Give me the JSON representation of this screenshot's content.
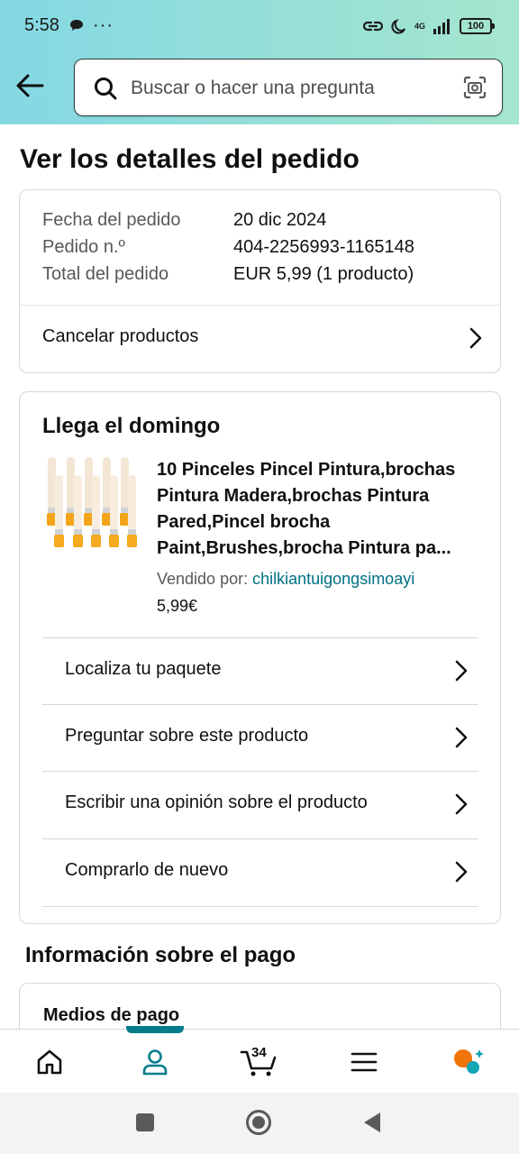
{
  "status_bar": {
    "time": "5:58",
    "more": "···",
    "network": "4G",
    "battery": "100"
  },
  "search": {
    "placeholder": "Buscar o hacer una pregunta"
  },
  "page": {
    "title": "Ver los detalles del pedido"
  },
  "order": {
    "date_label": "Fecha del pedido",
    "date_value": "20 dic 2024",
    "number_label": "Pedido n.º",
    "number_value": "404-2256993-1165148",
    "total_label": "Total del pedido",
    "total_value": "EUR 5,99 (1 producto)",
    "cancel_label": "Cancelar productos"
  },
  "shipment": {
    "arrival": "Llega el domingo",
    "product_title": "10 Pinceles Pincel Pintura,brochas Pintura Madera,brochas Pintura Pared,Pincel brocha Paint,Brushes,brocha Pintura pa...",
    "sold_by_label": "Vendido por:",
    "seller": "chilkiantuigongsimoayi",
    "price": "5,99€",
    "actions": [
      {
        "label": "Localiza tu paquete"
      },
      {
        "label": "Preguntar sobre este producto"
      },
      {
        "label": "Escribir una opinión sobre el producto"
      },
      {
        "label": "Comprarlo de nuevo"
      }
    ]
  },
  "payment": {
    "section_title": "Información sobre el pago",
    "methods_label": "Medios de pago"
  },
  "bottom_nav": {
    "cart_count": "34",
    "accent_color": "#067d8c"
  },
  "colors": {
    "link": "#007185",
    "header_gradient_start": "#84d8e3",
    "header_gradient_end": "#a5e6ce"
  }
}
